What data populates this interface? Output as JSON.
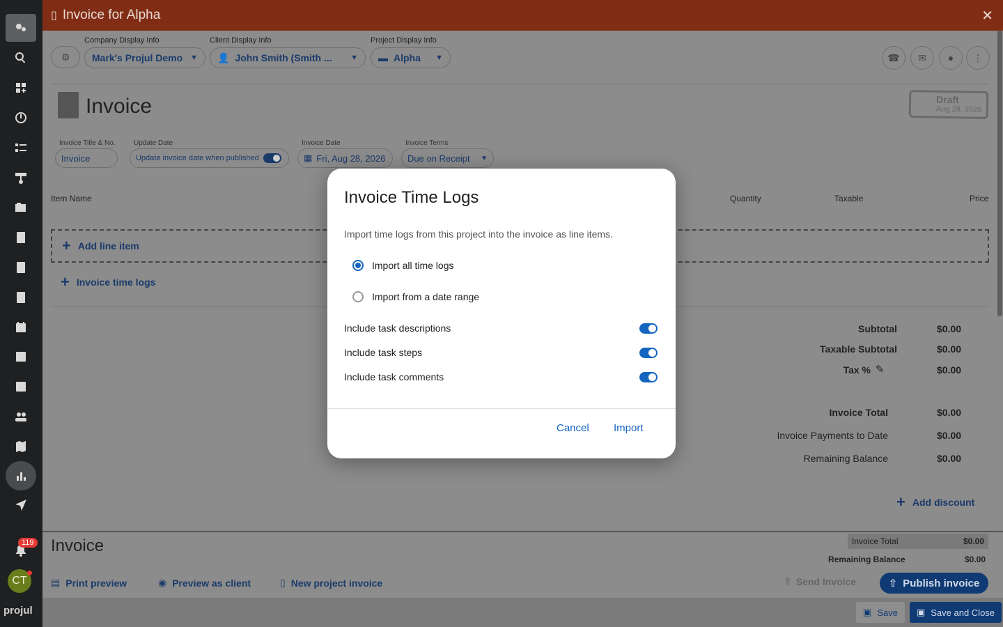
{
  "window": {
    "title": "Invoice for Alpha",
    "close": "✕"
  },
  "sidebar": {
    "badge_count": "119",
    "avatar_initials": "CT",
    "logo": "projul"
  },
  "header": {
    "company_label": "Company Display Info",
    "company_value": "Mark's Projul Demo",
    "client_label": "Client Display Info",
    "client_value": "John Smith (Smith ...",
    "project_label": "Project Display Info",
    "project_value": "Alpha"
  },
  "invoice": {
    "title": "Invoice",
    "status": "Draft",
    "status_date": "Aug 28, 2026",
    "title_no_label": "Invoice Title & No.",
    "title_no_value": "Invoice",
    "update_date_label": "Update Date",
    "update_date_value": "Update invoice date when published",
    "invoice_date_label": "Invoice Date",
    "invoice_date_value": "Fri, Aug 28, 2026",
    "terms_label": "Invoice Terms",
    "terms_value": "Due on Receipt"
  },
  "table": {
    "columns": [
      "Item Name",
      "Quantity",
      "Taxable",
      "Price"
    ],
    "add_line_item": "Add line item",
    "invoice_time_logs": "Invoice time logs"
  },
  "summary": {
    "subtotal_label": "Subtotal",
    "subtotal": "$0.00",
    "taxable_label": "Taxable Subtotal",
    "taxable": "$0.00",
    "tax_label": "Tax %",
    "tax": "$0.00",
    "total_label": "Invoice Total",
    "total": "$0.00",
    "payments_label": "Invoice Payments to Date",
    "payments": "$0.00",
    "remaining_label": "Remaining Balance",
    "remaining": "$0.00",
    "add_discount": "Add discount"
  },
  "footer": {
    "title": "Invoice",
    "print_preview": "Print preview",
    "preview_client": "Preview as client",
    "new_invoice": "New project invoice",
    "total_label": "Invoice Total",
    "total": "$0.00",
    "remaining_label": "Remaining Balance",
    "remaining": "$0.00",
    "send": "Send Invoice",
    "publish": "Publish invoice",
    "save": "Save",
    "save_close": "Save and Close"
  },
  "modal": {
    "title": "Invoice Time Logs",
    "description": "Import time logs from this project into the invoice as line items.",
    "option_all": "Import all time logs",
    "option_range": "Import from a date range",
    "selected_option": "all",
    "toggle_descriptions": "Include task descriptions",
    "toggle_steps": "Include task steps",
    "toggle_comments": "Include task comments",
    "cancel": "Cancel",
    "import": "Import"
  },
  "colors": {
    "accent": "#1565c0",
    "titlebar": "#812d15",
    "sidebar": "#1f2021"
  }
}
